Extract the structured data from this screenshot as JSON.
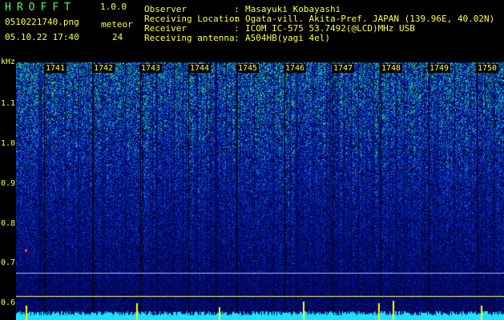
{
  "header": {
    "app_title": "HROFFT",
    "app_version": "1.0.0",
    "file_name": "0510221740.png",
    "datetime": "05.10.22 17:40",
    "meteor_label": "meteor",
    "meteor_count": "24"
  },
  "info": {
    "observer_label": "Observer",
    "observer_value": "Masayuki Kobayashi",
    "location_label": "Receiving Location",
    "location_value": "Ogata-vill. Akita-Pref. JAPAN (139.96E, 40.02N)",
    "receiver_label": "Receiver",
    "receiver_value": "ICOM IC-575 53.7492(@LCD)MHz USB",
    "antenna_label": "Receiving antenna",
    "antenna_value": "A504HB(yagi 4el)",
    "colon": ":"
  },
  "axis": {
    "y_unit": "kHz",
    "y_ticks": [
      "1.1",
      "1.0",
      "0.9",
      "0.8",
      "0.7",
      "0.6"
    ],
    "x_ticks": [
      "1741",
      "1742",
      "1743",
      "1744",
      "1745",
      "1746",
      "1747",
      "1748",
      "1749",
      "1750"
    ]
  },
  "colors": {
    "header_text": "#ffff40",
    "title_text": "#58ff58",
    "background": "#000000"
  }
}
